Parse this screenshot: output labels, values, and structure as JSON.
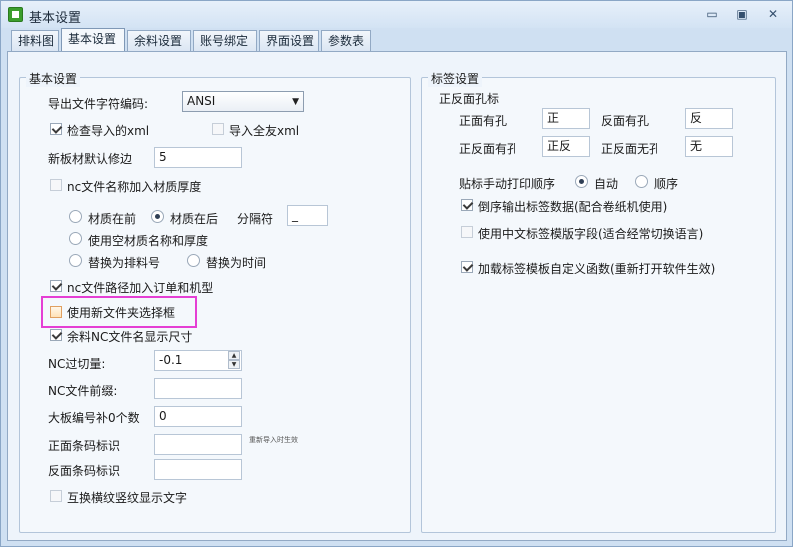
{
  "window": {
    "title": "基本设置",
    "minimize": "▭",
    "restore": "▣",
    "close": "✕"
  },
  "tabs": [
    "排料图",
    "基本设置",
    "余料设置",
    "账号绑定",
    "界面设置",
    "参数表"
  ],
  "active_tab": "基本设置",
  "basic": {
    "group_title": "基本设置",
    "encoding_label": "导出文件字符编码:",
    "encoding_value": "ANSI",
    "check_import_xml": "检查导入的xml",
    "import_quanyou_xml": "导入全友xml",
    "default_edge_label": "新板材默认修边",
    "default_edge_value": "5",
    "nc_add_material_thickness": "nc文件名称加入材质厚度",
    "material_front": "材质在前",
    "material_back": "材质在后",
    "separator_label": "分隔符",
    "separator_value": "_",
    "use_empty_material_name": "使用空材质名称和厚度",
    "replace_with_layout_no": "替换为排料号",
    "replace_with_time": "替换为时间",
    "nc_path_add_order": "nc文件路径加入订单和机型",
    "use_new_folder_dialog": "使用新文件夹选择框",
    "remnant_nc_show_size": "余料NC文件名显示尺寸",
    "nc_cut_label": "NC过切量:",
    "nc_cut_value": "-0.1",
    "nc_prefix_label": "NC文件前缀:",
    "nc_prefix_value": "",
    "board_no_pad_label": "大板编号补0个数",
    "board_no_pad_value": "0",
    "front_barcode_label": "正面条码标识",
    "front_barcode_value": "",
    "reimport_note": "重新导入时生效",
    "back_barcode_label": "反面条码标识",
    "back_barcode_value": "",
    "swap_grain_text": "互换横纹竖纹显示文字"
  },
  "label": {
    "group_title": "标签设置",
    "holes_title": "正反面孔标",
    "front_has_label": "正面有孔",
    "front_has_value": "正",
    "back_has_label": "反面有孔",
    "back_has_value": "反",
    "both_have_label": "正反面有孔",
    "both_have_value": "正反",
    "none_label": "正反面无孔",
    "none_value": "无",
    "print_order_label": "贴标手动打印顺序",
    "auto_label": "自动",
    "sequence_label": "顺序",
    "reverse_output": "倒序输出标签数据(配合卷纸机使用)",
    "use_chinese_fields": "使用中文标签模版字段(适合经常切换语言)",
    "load_custom_functions": "加载标签模板自定义函数(重新打开软件生效)"
  },
  "colors": {
    "highlight": "#e53fd4",
    "accent": "#3c9e2d"
  }
}
